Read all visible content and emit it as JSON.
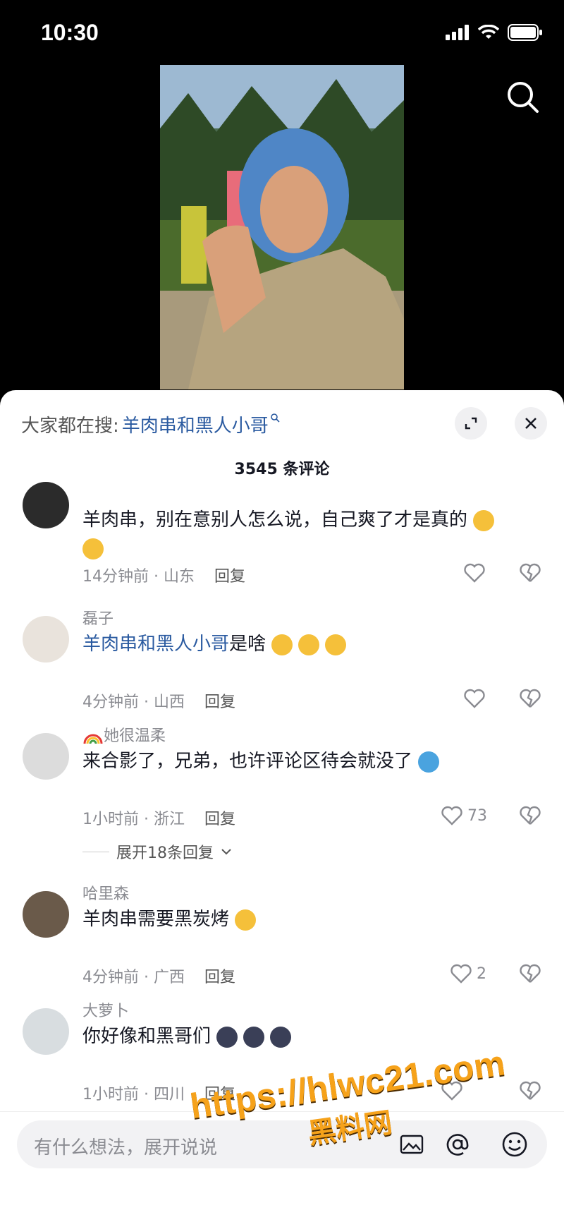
{
  "status_bar": {
    "time": "10:30"
  },
  "video": {
    "search_icon": "search-icon"
  },
  "sheet": {
    "trend_prefix": "大家都在搜:",
    "trend_keyword": "羊肉串和黑人小哥",
    "comment_count": "3545 条评论",
    "comments": [
      {
        "user": "",
        "text": "羊肉串，别在意别人怎么说，自己爽了才是真的",
        "time": "14分钟前 · 山东",
        "reply": "回复",
        "likes": ""
      },
      {
        "user": "磊子",
        "link": "羊肉串和黑人小哥",
        "text": "是啥",
        "time": "4分钟前 · 山西",
        "reply": "回复",
        "likes": ""
      },
      {
        "user": "她很温柔",
        "text": "来合影了，兄弟，也许评论区待会就没了",
        "time": "1小时前 · 浙江",
        "reply": "回复",
        "likes": "73",
        "expand": "展开18条回复"
      },
      {
        "user": "哈里森",
        "text": "羊肉串需要黑炭烤",
        "time": "4分钟前 · 广西",
        "reply": "回复",
        "likes": "2"
      },
      {
        "user": "大萝卜",
        "text": "你好像和黑哥们",
        "time": "1小时前 · 四川",
        "reply": "回复",
        "likes": ""
      }
    ]
  },
  "input": {
    "placeholder": "有什么想法，展开说说"
  },
  "watermark": {
    "url": "https://hlwc21.com",
    "name": "黑料网"
  },
  "colors": {
    "link": "#2a5aa0",
    "meta": "#8a8b91",
    "accent": "#f6a21a"
  }
}
